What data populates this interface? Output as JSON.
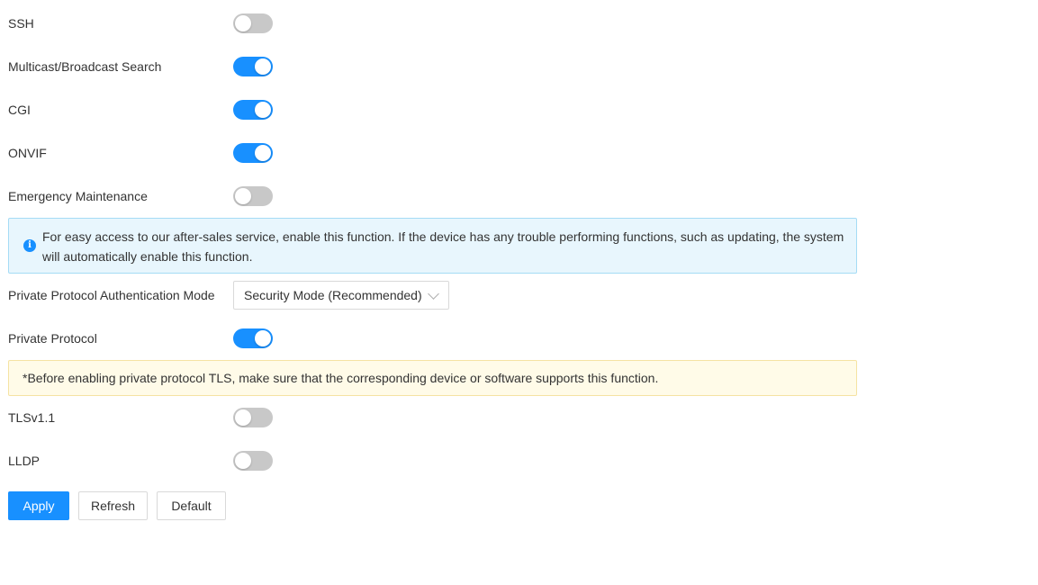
{
  "settings": {
    "ssh": {
      "label": "SSH",
      "enabled": false
    },
    "multicast": {
      "label": "Multicast/Broadcast Search",
      "enabled": true
    },
    "cgi": {
      "label": "CGI",
      "enabled": true
    },
    "onvif": {
      "label": "ONVIF",
      "enabled": true
    },
    "emergency": {
      "label": "Emergency Maintenance",
      "enabled": false
    },
    "emergency_notice": "For easy access to our after-sales service, enable this function. If the device has any trouble performing functions, such as updating, the system will automatically enable this function.",
    "auth_mode": {
      "label": "Private Protocol Authentication Mode",
      "value": "Security Mode (Recommended)"
    },
    "private_protocol": {
      "label": "Private Protocol",
      "enabled": true
    },
    "tls_notice": "*Before enabling private protocol TLS, make sure that the corresponding device or software supports this function.",
    "tlsv11": {
      "label": "TLSv1.1",
      "enabled": false
    },
    "lldp": {
      "label": "LLDP",
      "enabled": false
    }
  },
  "buttons": {
    "apply": "Apply",
    "refresh": "Refresh",
    "default": "Default"
  },
  "icons": {
    "info": "info-icon",
    "dropdown": "chevron-down-icon"
  },
  "colors": {
    "accent": "#1890ff",
    "toggle_off": "#c8c8c8",
    "info_bg": "#e8f6fd",
    "warn_bg": "#fffbe8"
  }
}
